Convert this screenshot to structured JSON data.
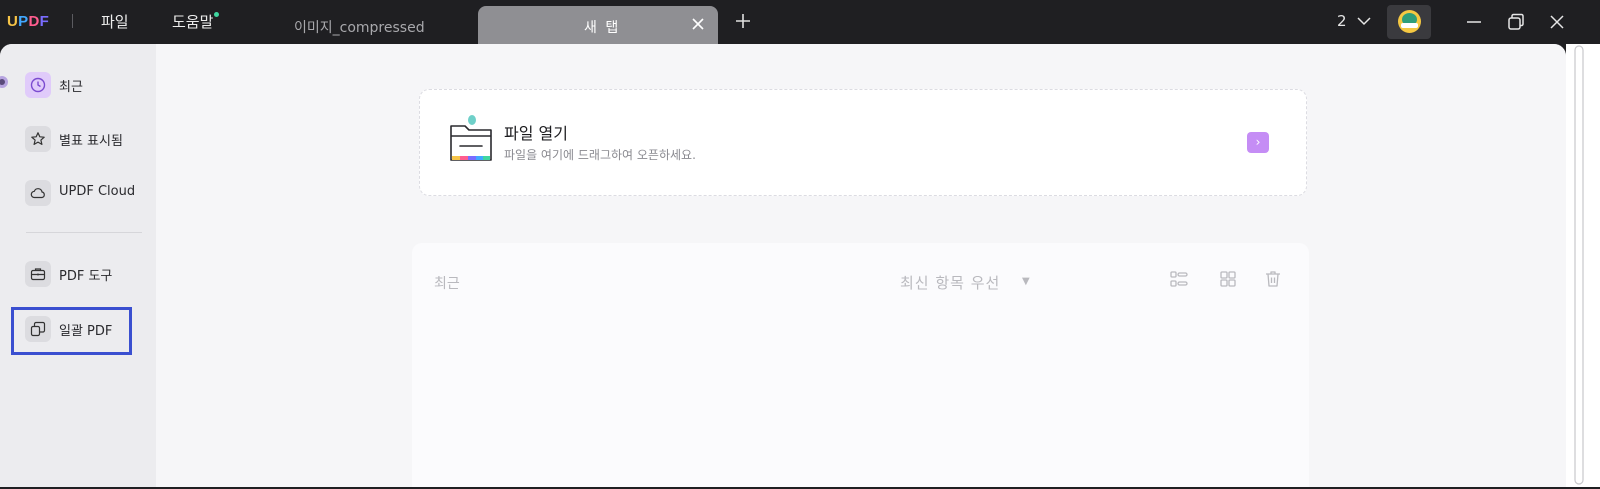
{
  "app": {
    "logo": {
      "part1": "U",
      "part2": "P",
      "part3": "D",
      "part4": "F"
    },
    "menu": {
      "file": "파일",
      "help": "도움말"
    },
    "tabs": [
      {
        "label": "이미지_compressed",
        "active": false
      },
      {
        "label": "새 탭",
        "active": true
      }
    ],
    "window_count": "2"
  },
  "sidebar": {
    "items": [
      {
        "label": "최근",
        "icon": "clock-icon",
        "active": true
      },
      {
        "label": "별표 표시됨",
        "icon": "star-icon"
      },
      {
        "label": "UPDF Cloud",
        "icon": "cloud-icon"
      },
      {
        "label": "PDF 도구",
        "icon": "briefcase-icon"
      },
      {
        "label": "일괄 PDF",
        "icon": "batch-icon",
        "highlighted": true
      }
    ]
  },
  "open_file": {
    "title": "파일 열기",
    "subtitle": "파일을 여기에 드래그하여 오픈하세요.",
    "arrow": "›"
  },
  "recent": {
    "title": "최근",
    "sort_label": "최신 항목 우선",
    "sort_caret": "▼"
  },
  "colors": {
    "accent": "#c58df5",
    "highlight_border": "#3a4fd0",
    "titlebar_bg": "#1f1f22"
  }
}
